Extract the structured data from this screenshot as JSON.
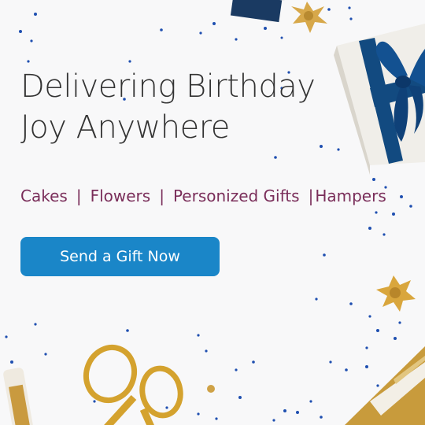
{
  "banner": {
    "headline_line1": "Delivering Birthday",
    "headline_line2": "Joy Anywhere",
    "categories": [
      "Cakes",
      "Flowers",
      "Personized Gifts",
      "Hampers"
    ],
    "separator": "|",
    "cta_label": "Send a Gift Now"
  },
  "colors": {
    "accent": "#1a86c8",
    "category_text": "#7a2e5a",
    "confetti_blue": "#1f4fb0",
    "gold": "#d9a63d"
  },
  "decorations": [
    "gift-box-icon",
    "gold-bow-icon",
    "scissors-icon",
    "confetti-icon",
    "gold-gift-wrap-icon"
  ]
}
